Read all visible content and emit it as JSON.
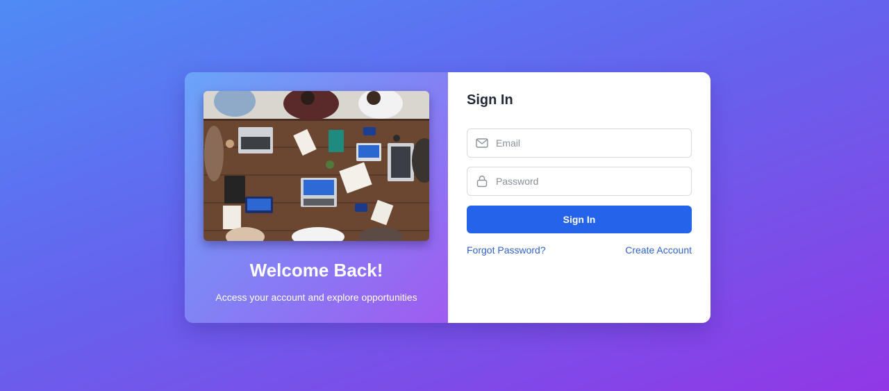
{
  "left_panel": {
    "title": "Welcome Back!",
    "subtitle": "Access your account and explore opportunities",
    "image_alt": "team meeting around a wooden table"
  },
  "form": {
    "heading": "Sign In",
    "email_placeholder": "Email",
    "password_placeholder": "Password",
    "submit_label": "Sign In",
    "forgot_label": "Forgot Password?",
    "create_label": "Create Account"
  },
  "icons": {
    "email": "mail-icon",
    "password": "lock-icon"
  },
  "colors": {
    "accent": "#2563eb",
    "link": "#2f62c9",
    "gradient_start": "#4f8bf5",
    "gradient_end": "#9237e6"
  }
}
